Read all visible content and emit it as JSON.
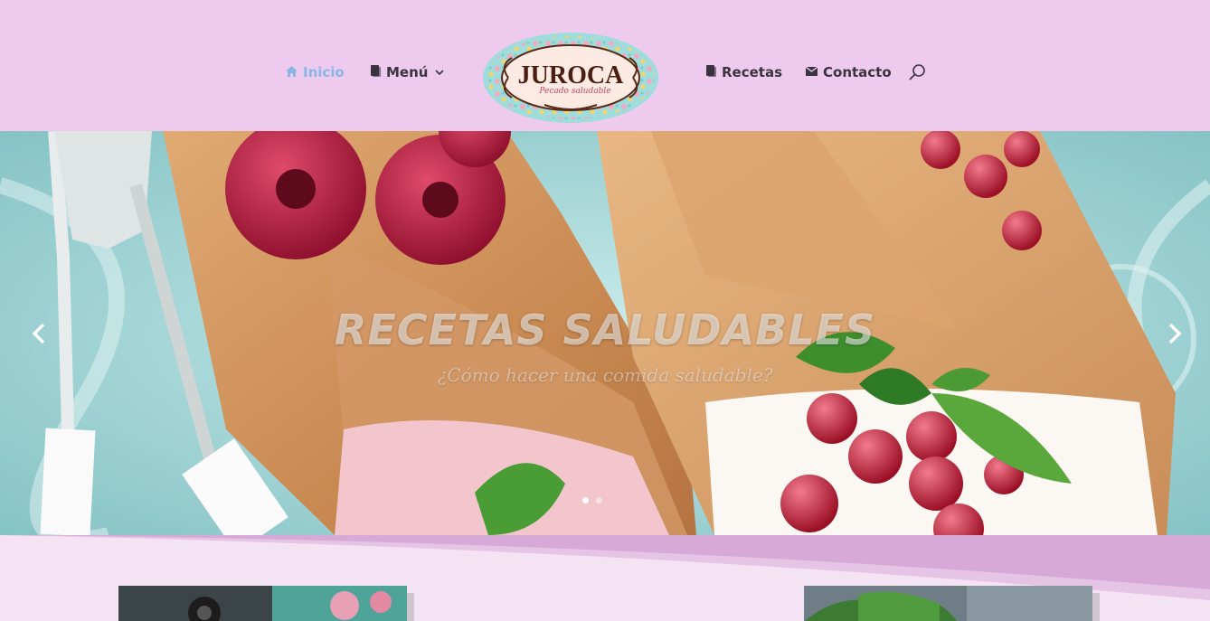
{
  "nav": {
    "items_left": [
      {
        "label": "Inicio",
        "icon": "home-icon",
        "active": true
      },
      {
        "label": "Menú",
        "icon": "book-icon",
        "has_dropdown": true
      }
    ],
    "items_right": [
      {
        "label": "Recetas",
        "icon": "book-icon"
      },
      {
        "label": "Contacto",
        "icon": "envelope-icon"
      }
    ],
    "search_icon": "search-icon"
  },
  "logo": {
    "name": "JUROCA",
    "tagline": "Pecado saludable"
  },
  "hero": {
    "title": "RECETAS SALUDABLES",
    "subtitle": "¿Cómo hacer una comida saludable?",
    "prev_icon": "chevron-left-icon",
    "next_icon": "chevron-right-icon",
    "slides": 2,
    "active_slide": 1
  },
  "colors": {
    "header_bg": "#eecbee",
    "active_nav": "#8ab6e6",
    "nav_text": "#3a3340",
    "lower_bg": "#f4e3f3",
    "wave": "#d6a9d6"
  }
}
